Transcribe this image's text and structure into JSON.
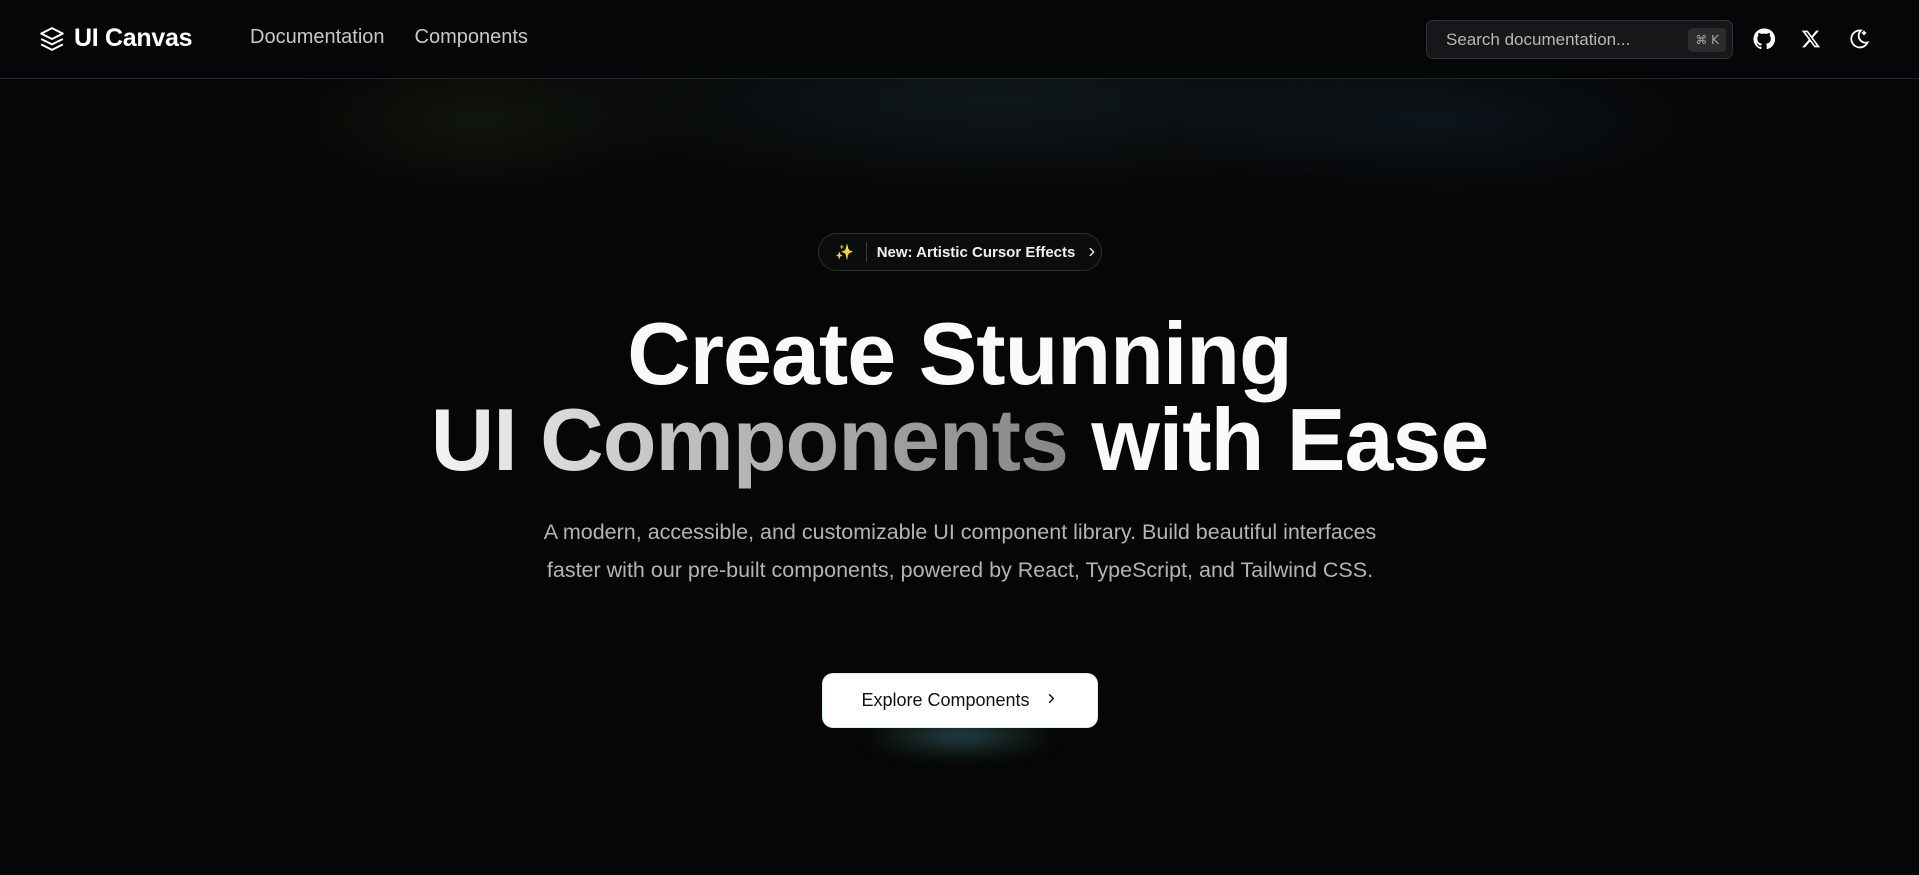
{
  "header": {
    "logo_text": "UI Canvas",
    "nav": [
      {
        "label": "Documentation"
      },
      {
        "label": "Components"
      }
    ],
    "search": {
      "placeholder": "Search documentation...",
      "shortcut": "⌘ K"
    },
    "icons": [
      "github-icon",
      "x-icon",
      "theme-toggle-icon"
    ]
  },
  "hero": {
    "badge": {
      "icon": "sparkles-icon",
      "label": "New: Artistic Cursor Effects"
    },
    "title_line1": "Create Stunning",
    "title_line2_gradient": "UI Components",
    "title_line2_rest": "with Ease",
    "subtitle": "A modern, accessible, and customizable UI component library. Build beautiful interfaces faster with our pre-built components, powered by React, TypeScript, and Tailwind CSS.",
    "cta_label": "Explore Components"
  },
  "colors": {
    "background": "#060606",
    "text": "#fafafa",
    "muted": "#b4b4b4",
    "badge_sparkle": "#f5b84a"
  }
}
